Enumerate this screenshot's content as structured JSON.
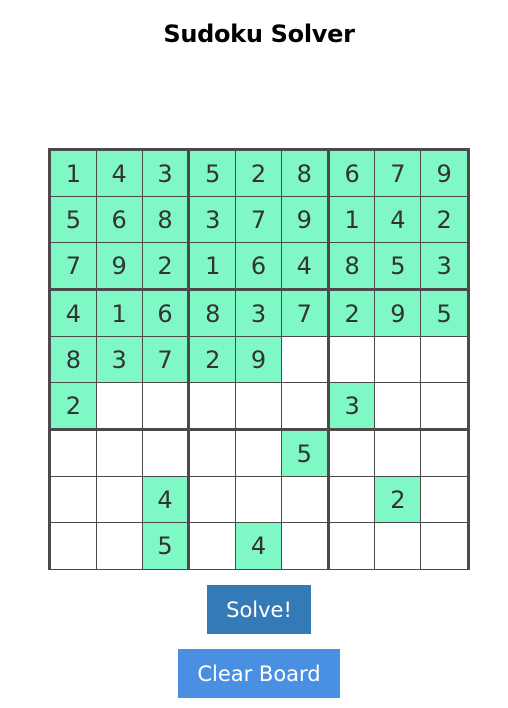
{
  "page": {
    "title": "Sudoku Solver"
  },
  "colors": {
    "filled_cell": "#7ff8c6",
    "empty_cell": "#ffffff",
    "grid_line": "#4a4a4a",
    "solve_button": "#337ab7",
    "clear_button": "#4a90e2"
  },
  "board": {
    "rows": [
      [
        "1",
        "4",
        "3",
        "5",
        "2",
        "8",
        "6",
        "7",
        "9"
      ],
      [
        "5",
        "6",
        "8",
        "3",
        "7",
        "9",
        "1",
        "4",
        "2"
      ],
      [
        "7",
        "9",
        "2",
        "1",
        "6",
        "4",
        "8",
        "5",
        "3"
      ],
      [
        "4",
        "1",
        "6",
        "8",
        "3",
        "7",
        "2",
        "9",
        "5"
      ],
      [
        "8",
        "3",
        "7",
        "2",
        "9",
        "",
        "",
        "",
        ""
      ],
      [
        "2",
        "",
        "",
        "",
        "",
        "",
        "3",
        "",
        ""
      ],
      [
        "",
        "",
        "",
        "",
        "",
        "5",
        "",
        "",
        ""
      ],
      [
        "",
        "",
        "4",
        "",
        "",
        "",
        "",
        "2",
        ""
      ],
      [
        "",
        "",
        "5",
        "",
        "4",
        "",
        "",
        "",
        ""
      ]
    ]
  },
  "buttons": {
    "solve_label": "Solve!",
    "clear_label": "Clear Board"
  }
}
